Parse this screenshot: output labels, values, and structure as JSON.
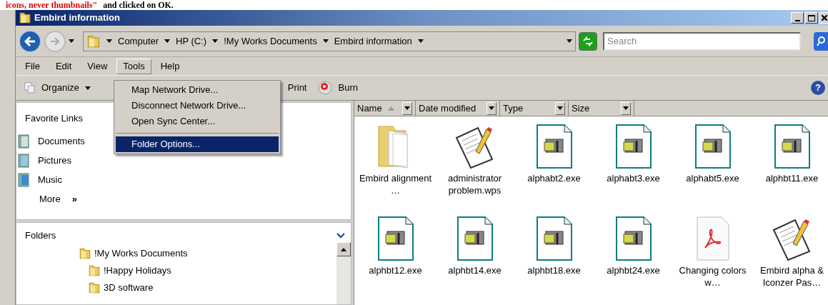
{
  "caption": {
    "parts": [
      {
        "text": "icons, never thumbnails\"",
        "kind": "highlight"
      },
      {
        "text": "and clicked on OK.",
        "kind": "plain"
      }
    ]
  },
  "window": {
    "title": "Embird information"
  },
  "address_bar": {
    "breadcrumbs": [
      "Computer",
      "HP (C:)",
      "!My Works Documents",
      "Embird information"
    ]
  },
  "search": {
    "placeholder": "Search"
  },
  "help": {
    "glyph": "?"
  },
  "menu_bar": [
    {
      "label": "File",
      "selected": false
    },
    {
      "label": "Edit",
      "selected": false
    },
    {
      "label": "View",
      "selected": false
    },
    {
      "label": "Tools",
      "selected": true
    },
    {
      "label": "Help",
      "selected": false
    }
  ],
  "tools_menu": {
    "groups": [
      [
        {
          "label": "Map Network Drive...",
          "selected": false
        },
        {
          "label": "Disconnect Network Drive...",
          "selected": false
        },
        {
          "label": "Open Sync Center...",
          "selected": false
        }
      ],
      [
        {
          "label": "Folder Options...",
          "selected": true
        }
      ]
    ]
  },
  "toolbar": [
    {
      "label": "Organize",
      "kind": "organize"
    },
    {
      "label": "Print",
      "kind": "print"
    },
    {
      "label": "Burn",
      "kind": "burn"
    }
  ],
  "favorite_links": {
    "title": "Favorite Links",
    "items": [
      {
        "label": "Documents",
        "kind": "documents"
      },
      {
        "label": "Pictures",
        "kind": "pictures"
      },
      {
        "label": "Music",
        "kind": "music"
      }
    ],
    "more": "More",
    "more_glyph": "»"
  },
  "folders": {
    "title": "Folders",
    "tree": [
      {
        "label": "!My Works Documents",
        "children": [
          {
            "label": "!Happy Holidays"
          },
          {
            "label": "3D software"
          }
        ]
      }
    ]
  },
  "columns": [
    {
      "label": "Name",
      "sorted": true
    },
    {
      "label": "Date modified",
      "sorted": false
    },
    {
      "label": "Type",
      "sorted": false
    },
    {
      "label": "Size",
      "sorted": false
    }
  ],
  "files": [
    {
      "name": "Embird alignment …",
      "kind": "folder"
    },
    {
      "name": "administrator problem.wps",
      "kind": "document"
    },
    {
      "name": "alphabt2.exe",
      "kind": "exe"
    },
    {
      "name": "alphabt3.exe",
      "kind": "exe"
    },
    {
      "name": "alphabt5.exe",
      "kind": "exe"
    },
    {
      "name": "alphbt11.exe",
      "kind": "exe"
    },
    {
      "name": "alphbt12.exe",
      "kind": "exe"
    },
    {
      "name": "alphbt14.exe",
      "kind": "exe"
    },
    {
      "name": "alphbt18.exe",
      "kind": "exe"
    },
    {
      "name": "alphbt24.exe",
      "kind": "exe"
    },
    {
      "name": "Changing colors w…",
      "kind": "pdf"
    },
    {
      "name": "Embird alpha & Iconzer Pas…",
      "kind": "document"
    }
  ]
}
